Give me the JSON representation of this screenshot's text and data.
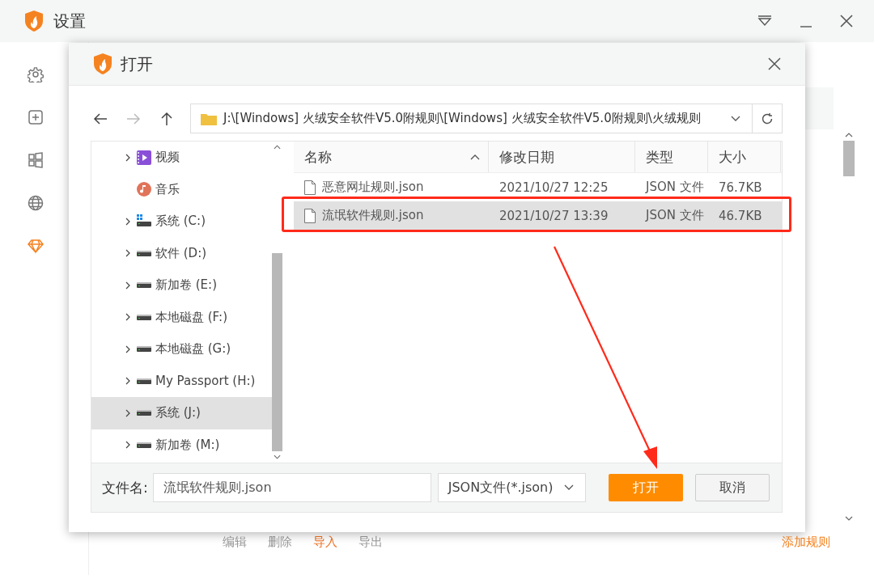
{
  "app": {
    "title": "设置",
    "sidebar": [
      {
        "kind": "gear",
        "selected": false
      },
      {
        "kind": "plus",
        "selected": false
      },
      {
        "kind": "tiles",
        "selected": false
      },
      {
        "kind": "globe",
        "selected": false
      },
      {
        "kind": "diamond",
        "selected": true
      }
    ],
    "actions": [
      {
        "label": "编辑",
        "selected": false
      },
      {
        "label": "删除",
        "selected": false
      },
      {
        "label": "导入",
        "selected": true
      },
      {
        "label": "导出",
        "selected": false
      }
    ],
    "add_rule": "添加规则"
  },
  "dialog": {
    "title": "打开",
    "nav": [
      {
        "kind": "back",
        "disabled": false
      },
      {
        "kind": "forward",
        "disabled": true
      },
      {
        "kind": "up",
        "disabled": false
      }
    ],
    "address": "J:\\[Windows] 火绒安全软件V5.0附规则\\[Windows] 火绒安全软件V5.0附规则\\火绒规则",
    "tree": [
      {
        "label": "视频",
        "kind": "video",
        "expandable": true,
        "selected": false
      },
      {
        "label": "音乐",
        "kind": "music",
        "expandable": false,
        "selected": false
      },
      {
        "label": "系统 (C:)",
        "kind": "system",
        "expandable": true,
        "selected": false
      },
      {
        "label": "软件 (D:)",
        "kind": "drive",
        "expandable": true,
        "selected": false
      },
      {
        "label": "新加卷 (E:)",
        "kind": "drive",
        "expandable": true,
        "selected": false
      },
      {
        "label": "本地磁盘 (F:)",
        "kind": "drive",
        "expandable": true,
        "selected": false
      },
      {
        "label": "本地磁盘 (G:)",
        "kind": "drive",
        "expandable": true,
        "selected": false
      },
      {
        "label": "My Passport (H:)",
        "kind": "drive",
        "expandable": true,
        "selected": false
      },
      {
        "label": "系统 (J:)",
        "kind": "drive",
        "expandable": true,
        "selected": true
      },
      {
        "label": "新加卷 (M:)",
        "kind": "drive",
        "expandable": true,
        "selected": false
      }
    ],
    "columns": [
      {
        "label": "名称",
        "sorted": true
      },
      {
        "label": "修改日期",
        "sorted": false
      },
      {
        "label": "类型",
        "sorted": false
      },
      {
        "label": "大小",
        "sorted": false
      }
    ],
    "files": [
      {
        "name": "恶意网址规则.json",
        "date": "2021/10/27 12:25",
        "type": "JSON 文件",
        "size": "76.7KB",
        "selected": false
      },
      {
        "name": "流氓软件规则.json",
        "date": "2021/10/27 13:39",
        "type": "JSON 文件",
        "size": "46.7KB",
        "selected": true
      }
    ],
    "filename_label": "文件名:",
    "filename": "流氓软件规则.json",
    "filter": "JSON文件(*.json)",
    "buttons": [
      {
        "label": "打开",
        "kind": "primary"
      },
      {
        "label": "取消",
        "kind": "secondary"
      }
    ]
  },
  "annotations": {
    "frame": true,
    "arrow": true
  }
}
